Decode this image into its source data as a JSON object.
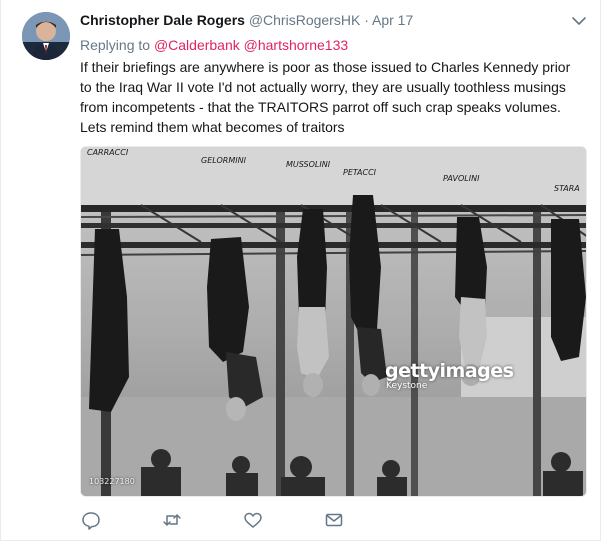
{
  "tweet": {
    "author": {
      "fullname": "Christopher Dale Rogers",
      "username": "@ChrisRogersHK",
      "separator": "·",
      "timestamp": "Apr 17"
    },
    "reply": {
      "prefix": "Replying to ",
      "mentions": [
        "@Calderbank",
        "@hartshorne133"
      ]
    },
    "text_lines": [
      "If their briefings are anywhere is poor as those issued to Charles Kennedy prior",
      "to the Iraq War II vote I'd not actually worry, they are usually toothless musings",
      "from incompetents - that the TRAITORS parrot off such crap speaks volumes.",
      "Lets remind them what becomes of traitors"
    ],
    "media": {
      "signage": [
        "CARRACCI",
        "GELORMINI",
        "MUSSOLINI",
        "PETACCI",
        "PAVOLINI",
        "STARA"
      ],
      "watermark_brand": "gettyimages",
      "watermark_credit": "Keystone",
      "image_id": "103227180"
    },
    "actions": [
      "reply-icon",
      "retweet-icon",
      "like-icon",
      "direct-message-icon"
    ],
    "colors": {
      "mention": "#e0245e",
      "meta_text": "#657786",
      "body_text": "#14171a",
      "icon": "#657786"
    }
  }
}
